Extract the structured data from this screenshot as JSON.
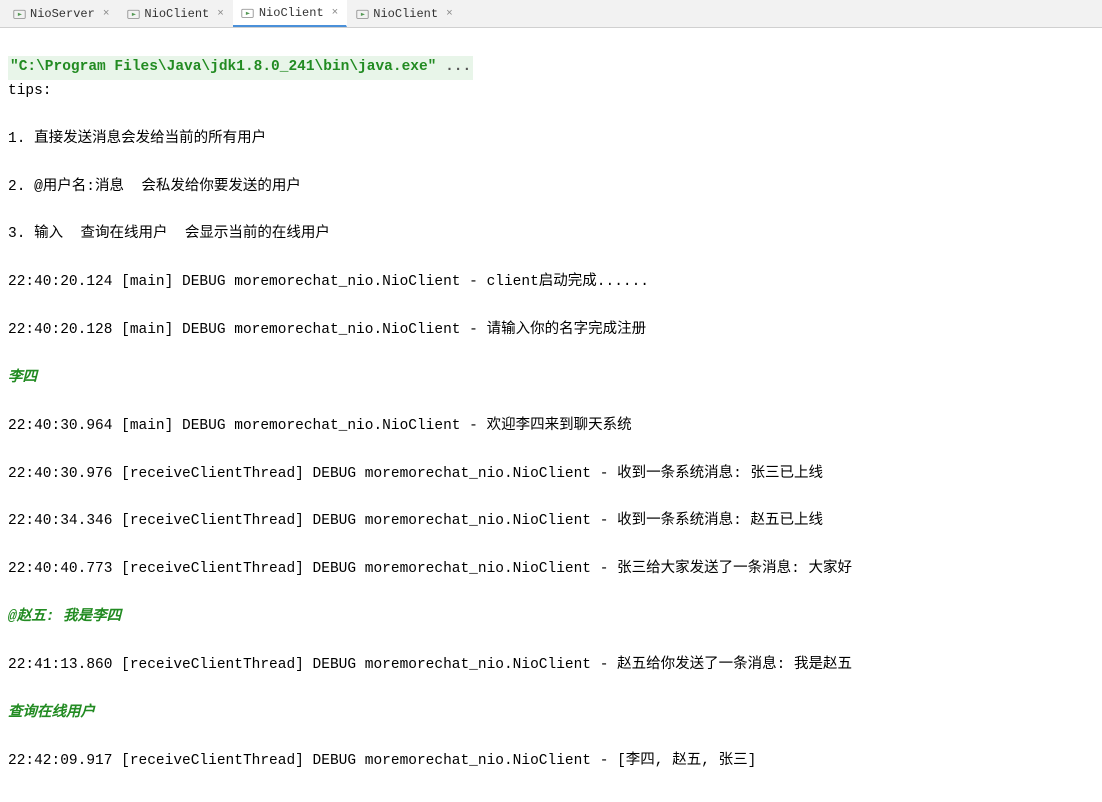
{
  "tabs": [
    {
      "label": "NioServer",
      "active": false
    },
    {
      "label": "NioClient",
      "active": false
    },
    {
      "label": "NioClient",
      "active": true
    },
    {
      "label": "NioClient",
      "active": false
    }
  ],
  "command": {
    "quoted": "\"C:\\Program Files\\Java\\jdk1.8.0_241\\bin\\java.exe\"",
    "rest": " ..."
  },
  "lines": {
    "tips_header": "tips:",
    "tip1": "1. 直接发送消息会发给当前的所有用户",
    "tip2": "2. @用户名:消息  会私发给你要发送的用户",
    "tip3": "3. 输入  查询在线用户  会显示当前的在线用户",
    "log1": "22:40:20.124 [main] DEBUG moremorechat_nio.NioClient - client启动完成......",
    "log2": "22:40:20.128 [main] DEBUG moremorechat_nio.NioClient - 请输入你的名字完成注册",
    "input1": "李四",
    "log3": "22:40:30.964 [main] DEBUG moremorechat_nio.NioClient - 欢迎李四来到聊天系统",
    "log4": "22:40:30.976 [receiveClientThread] DEBUG moremorechat_nio.NioClient - 收到一条系统消息: 张三已上线",
    "log5": "22:40:34.346 [receiveClientThread] DEBUG moremorechat_nio.NioClient - 收到一条系统消息: 赵五已上线",
    "log6": "22:40:40.773 [receiveClientThread] DEBUG moremorechat_nio.NioClient - 张三给大家发送了一条消息: 大家好",
    "input2": "@赵五: 我是李四",
    "log7": "22:41:13.860 [receiveClientThread] DEBUG moremorechat_nio.NioClient - 赵五给你发送了一条消息: 我是赵五",
    "input3": "查询在线用户",
    "log8": "22:42:09.917 [receiveClientThread] DEBUG moremorechat_nio.NioClient - [李四, 赵五, 张三]"
  },
  "icon_colors": {
    "tab_run": "#6fa8dc"
  },
  "close_glyph": "×"
}
